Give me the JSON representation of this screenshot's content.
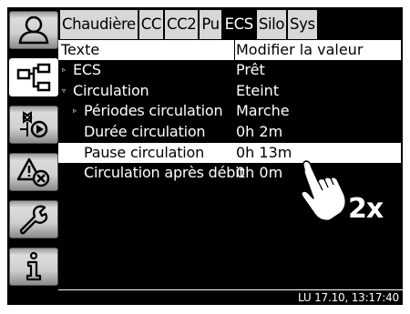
{
  "tabs": [
    {
      "label": "Chaudière",
      "active": false
    },
    {
      "label": "CC",
      "active": false
    },
    {
      "label": "CC2",
      "active": false
    },
    {
      "label": "Pu",
      "active": false
    },
    {
      "label": "ECS",
      "active": true
    },
    {
      "label": "Silo",
      "active": false
    },
    {
      "label": "Sys",
      "active": false
    }
  ],
  "sidebar": {
    "items": [
      {
        "icon": "user-icon"
      },
      {
        "icon": "hierarchy-icon",
        "active": true
      },
      {
        "icon": "pump-valve-icon"
      },
      {
        "icon": "warning-icon"
      },
      {
        "icon": "wrench-icon"
      },
      {
        "icon": "info-icon"
      }
    ]
  },
  "table": {
    "headers": {
      "name": "Texte",
      "value": "Modifier la valeur"
    },
    "rows": [
      {
        "expander": "▹",
        "label": "ECS",
        "value": "Prêt"
      },
      {
        "expander": "▿",
        "label": "Circulation",
        "value": "Eteint"
      },
      {
        "expander": "▹",
        "label": "Périodes circulation",
        "value": "Marche"
      },
      {
        "expander": "",
        "label": "Durée circulation",
        "value": "0h 2m"
      },
      {
        "expander": "",
        "label": "Pause circulation",
        "value": "0h 13m",
        "selected": true
      },
      {
        "expander": "",
        "label": "Circulation après débit",
        "value": "0h 0m"
      }
    ]
  },
  "status": {
    "datetime": "LU 17.10, 13:17:40"
  },
  "gesture": {
    "count": "2x",
    "icon": "tap-hand-icon"
  },
  "colors": {
    "background": "#000000",
    "selection": "#ffffff",
    "tab": "#d7d7d7",
    "text": "#ffffff"
  }
}
